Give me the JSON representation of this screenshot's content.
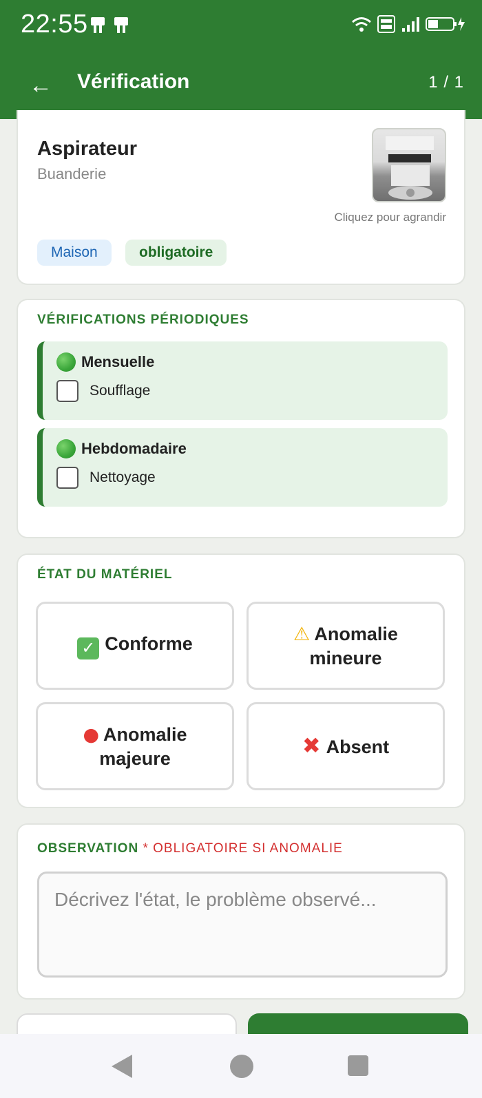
{
  "status_bar": {
    "time": "22:55"
  },
  "app_bar": {
    "title": "Vérification",
    "counter": "1 / 1",
    "back_glyph": "←"
  },
  "equipment": {
    "name": "Aspirateur",
    "location": "Buanderie",
    "zoom_hint": "Cliquez pour agrandir",
    "tags": [
      "Maison",
      "obligatoire"
    ]
  },
  "periodic": {
    "title": "VÉRIFICATIONS PÉRIODIQUES",
    "groups": [
      {
        "label": "Mensuelle",
        "task": "Soufflage",
        "checked": false
      },
      {
        "label": "Hebdomadaire",
        "task": "Nettoyage",
        "checked": false
      }
    ]
  },
  "state": {
    "title": "ÉTAT DU MATÉRIEL",
    "options": {
      "conforme": "Conforme",
      "mineure": "Anomalie mineure",
      "majeure": "Anomalie majeure",
      "absent": "Absent"
    }
  },
  "observation": {
    "title": "OBSERVATION",
    "required": "* OBLIGATOIRE SI ANOMALIE",
    "placeholder": "Décrivez l'état, le problème observé..."
  },
  "colors": {
    "primary": "#2e7d32",
    "danger": "#d32f2f",
    "info": "#1e66b4"
  }
}
